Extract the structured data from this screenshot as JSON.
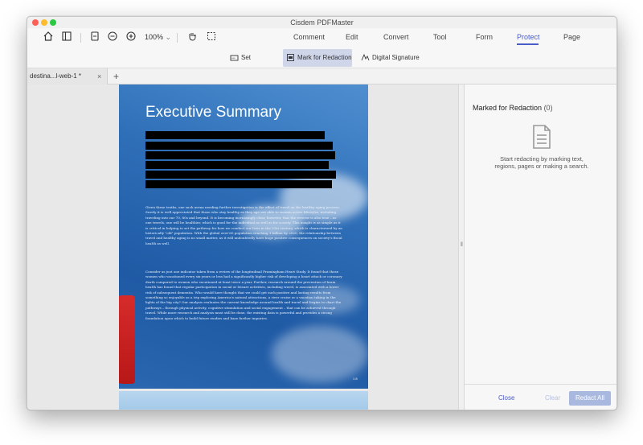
{
  "window": {
    "title": "Cisdem PDFMaster"
  },
  "toolbar": {
    "zoom": "100%",
    "icons": [
      "home-icon",
      "sidebar-icon",
      "page-icon",
      "zoom-out-icon",
      "zoom-in-icon",
      "hand-icon",
      "select-icon"
    ],
    "tabs": [
      {
        "label": "Comment"
      },
      {
        "label": "Edit"
      },
      {
        "label": "Convert"
      },
      {
        "label": "Tool"
      },
      {
        "label": "Form"
      },
      {
        "label": "Protect",
        "active": true
      },
      {
        "label": "Page"
      }
    ]
  },
  "subtoolbar": {
    "set_password": "Set Password",
    "mark_redaction": "Mark for Redaction",
    "digital_signature": "Digital Signature"
  },
  "doc_tabs": {
    "current": "destina...l-web-1 *",
    "close": "×",
    "add": "+"
  },
  "page": {
    "title": "Executive Summary",
    "para1": "Given these truths, one such arena needing further investigation is the effect of travel on the healthy aging process. Surely it is well appreciated that those who stay healthy as they age are able to sustain active lifestyles, including traveling into our 70, 80s and beyond. It is becoming increasingly clear, however, that the reverse is also true – as one travels, one will be healthier, which is good for the individual as well as for society. This insight is as simple as it is critical in helping to set the pathway for how we conduct our lives in the 21st century, which is characterized by an historically \"old\" population. With the global over-60 population reaching 1 billion by 2020, the relationship between travel and healthy aging is no small matter, as it will undoubtedly have huge positive consequences on society's fiscal health as well.",
    "para2": "Consider as just one indicator taken from a review of the longitudinal Framingham Heart Study. It found that those women who vacationed every six years or less had a significantly higher risk of developing a heart attack or coronary death compared to women who vacationed at least twice a year. Further, research around the prevention of brain health has found that regular participation in social or leisure activities, including travel, is associated with a lower risk of subsequent dementia. Who would have thought that we could get such positive and lasting results from something so enjoyable as a trip exploring America's natural attractions, a river cruise or a vacation taking in the lights of the big city? Our analysis evaluates the current knowledge around health and travel and begins to chart the pathways – through physical activity, cognitive stimulation and social engagement – that can be achieved through travel. While more research and analysis must still be done, the existing data is powerful and provides a strong foundation upon which to build future studies and base further inquiries.",
    "page_number": "1 8"
  },
  "panel": {
    "title": "Marked for Redaction",
    "count": "(0)",
    "message": "Start redacting by marking text, regions, pages or making a search.",
    "close": "Close",
    "clear": "Clear",
    "redact_all": "Redact All"
  },
  "colors": {
    "accent": "#4a5cc8",
    "redact_button": "#a9b8de",
    "active_sub": "#cfd6ea"
  }
}
